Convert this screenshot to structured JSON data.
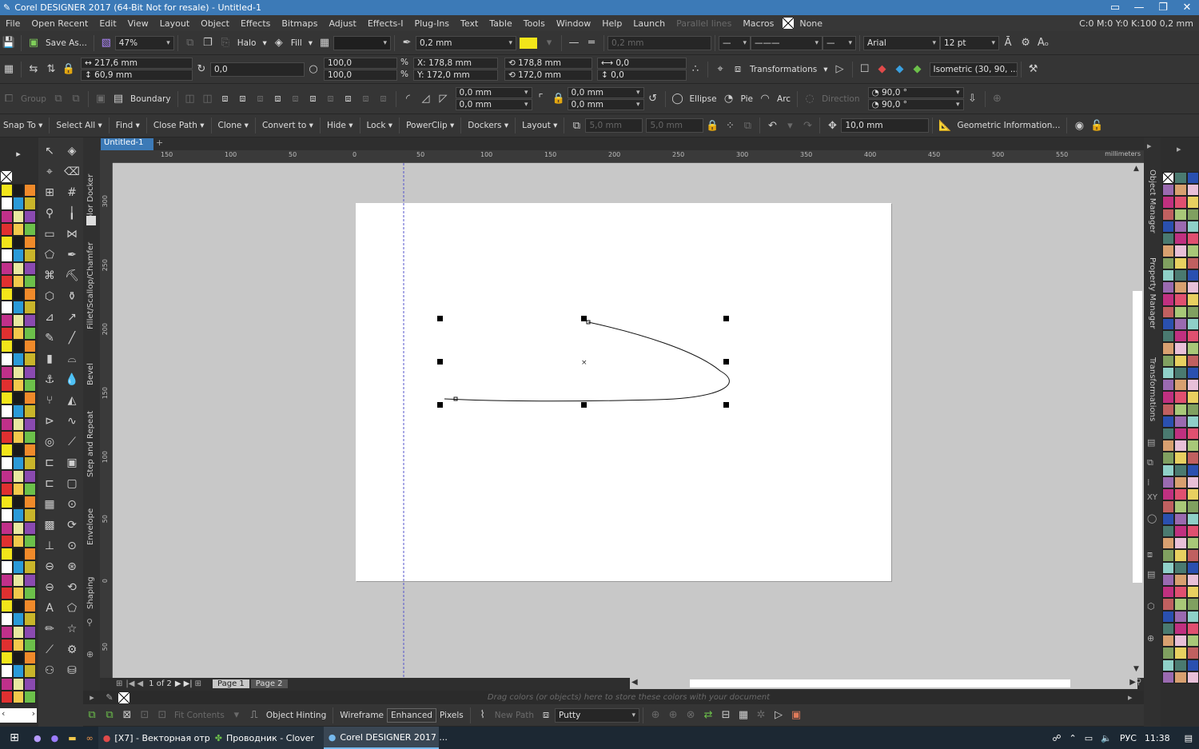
{
  "window": {
    "title": "Corel DESIGNER 2017 (64-Bit Not for resale) - Untitled-1"
  },
  "menu": [
    "File",
    "Open Recent",
    "Edit",
    "View",
    "Layout",
    "Object",
    "Effects",
    "Bitmaps",
    "Adjust",
    "Effects-I",
    "Plug-Ins",
    "Text",
    "Table",
    "Tools",
    "Window",
    "Help",
    "Launch",
    "Parallel lines",
    "Macros"
  ],
  "menu_right": {
    "fill_none": "None",
    "color_info": "C:0 M:0 Y:0 K:100  0,2 mm"
  },
  "toolbar1": {
    "save_as": "Save As...",
    "zoom": "47%",
    "halo": "Halo",
    "fill": "Fill",
    "outline_width": "0,2 mm",
    "outline_width2": "0,2 mm",
    "font": "Arial",
    "font_size": "12 pt"
  },
  "toolbar2": {
    "width": "217,6 mm",
    "height": "60,9 mm",
    "angle": "0,0",
    "scale_x": "100,0",
    "scale_y": "100,0",
    "pct": "%",
    "pos_x_label": "X:",
    "pos_x": "178,8 mm",
    "pos_y_label": "Y:",
    "pos_y": "172,0 mm",
    "pos_x2": "178,8 mm",
    "pos_y2": "172,0 mm",
    "skew1": "0,0",
    "skew2": "0,0",
    "transformations": "Transformations",
    "projection": "Isometric (30, 90, ..."
  },
  "toolbar3": {
    "group": "Group",
    "boundary": "Boundary",
    "corner1": "0,0 mm",
    "corner2": "0,0 mm",
    "corner3": "0,0 mm",
    "corner4": "0,0 mm",
    "ellipse": "Ellipse",
    "pie": "Pie",
    "arc": "Arc",
    "direction": "Direction",
    "angle1": "90,0 °",
    "angle2": "90,0 °"
  },
  "toolbar4": [
    "Snap To",
    "Select All",
    "Find",
    "Close Path",
    "Clone",
    "Convert to",
    "Hide",
    "Lock",
    "PowerClip",
    "Dockers",
    "Layout"
  ],
  "toolbar4_fields": {
    "dup1": "5,0 mm",
    "dup2": "5,0 mm",
    "nudge": "10,0 mm",
    "geometric": "Geometric Information..."
  },
  "document_tab": "Untitled-1",
  "ruler": {
    "units": "millimeters",
    "top": [
      "150",
      "100",
      "50",
      "0",
      "50",
      "100",
      "150",
      "200",
      "250",
      "300",
      "350",
      "400",
      "450",
      "500",
      "550"
    ],
    "left": [
      "300",
      "250",
      "200",
      "150",
      "100",
      "50",
      "0",
      "50"
    ]
  },
  "dockers_left": [
    "Color Docker",
    "Fillet/Scallop/Chamfer",
    "Bevel",
    "Step and Repeat",
    "Envelope",
    "Shaping"
  ],
  "dockers_right": [
    "Object Manager",
    "Property Manager",
    "Transformations"
  ],
  "page_nav": {
    "counter": "1 of 2",
    "pages": [
      "Page 1",
      "Page 2"
    ]
  },
  "status": {
    "hint": "Drag colors (or objects) here to store these colors with your document"
  },
  "bottombar": {
    "fit_contents": "Fit Contents",
    "object_hinting": "Object Hinting",
    "wireframe": "Wireframe",
    "enhanced": "Enhanced",
    "pixels": "Pixels",
    "new_path": "New Path",
    "putty": "Putty"
  },
  "taskbar": {
    "tasks": [
      "[X7] - Векторная отр...",
      "Проводник - Clover",
      "Corel DESIGNER 2017 ..."
    ],
    "lang": "РУС",
    "time": "11:38"
  },
  "colors": {
    "accent": "#3c7ab7",
    "fill_swatch": "#f2e51a"
  }
}
